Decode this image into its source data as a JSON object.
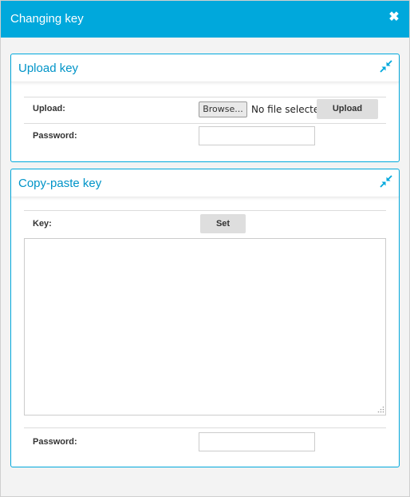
{
  "dialog": {
    "title": "Changing key",
    "close_icon": "close-icon"
  },
  "upload_panel": {
    "title": "Upload key",
    "collapse_icon": "collapse-arrows-icon",
    "upload_label": "Upload:",
    "browse_label": "Browse...",
    "file_status": "No file selected.",
    "upload_button": "Upload",
    "password_label": "Password:",
    "password_value": ""
  },
  "paste_panel": {
    "title": "Copy-paste key",
    "collapse_icon": "collapse-arrows-icon",
    "key_label": "Key:",
    "set_button": "Set",
    "key_value": "",
    "password_label": "Password:",
    "password_value": ""
  },
  "colors": {
    "accent": "#00a8dc",
    "panel_title": "#0094c8",
    "button_bg": "#dedede"
  }
}
